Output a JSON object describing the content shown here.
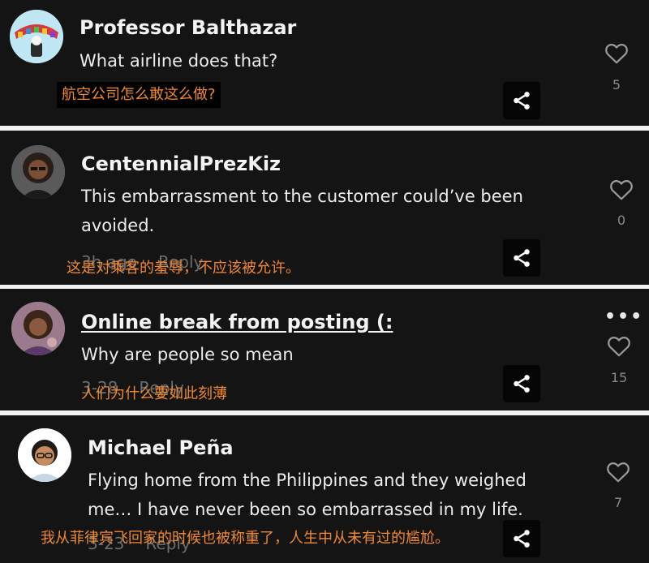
{
  "comments": [
    {
      "username": "Professor Balthazar",
      "text_lines": [
        "What airline does that?"
      ],
      "time": "",
      "reply_label": "",
      "likes": "5",
      "subtitle": "航空公司怎么敢这么做?",
      "avatar_icon": "cartoon-avatar-icon"
    },
    {
      "username": "CentennialPrezKiz",
      "text_lines": [
        "This embarrassment to the customer could’ve been",
        "avoided."
      ],
      "time": "3h ago",
      "reply_label": "Reply",
      "likes": "0",
      "subtitle": "这是对乘客的羞辱，不应该被允许。",
      "avatar_icon": "user-photo-icon"
    },
    {
      "username": "Online break from posting (:",
      "text_lines": [
        "Why are people so mean"
      ],
      "time": "3-28",
      "reply_label": "Reply",
      "likes": "15",
      "subtitle": "人们为什么要如此刻薄",
      "avatar_icon": "user-photo-icon",
      "more_label": "•••"
    },
    {
      "username": "Michael Peña",
      "text_lines": [
        "Flying home from the Philippines and they weighed",
        "me… I have never been so embarrassed in my life."
      ],
      "time": "3-23",
      "reply_label": "Reply",
      "likes": "7",
      "subtitle": "我从菲律宾飞回家的时候也被称重了，人生中从未有过的尴尬。",
      "avatar_icon": "user-photo-icon"
    }
  ],
  "colors": {
    "card_bg": "#141414",
    "separator": "#f2f2f2",
    "subtitle": "#f0882f",
    "username": "#f3f3f3",
    "meta": "#6d6d6d"
  },
  "icons": {
    "share": "share-icon",
    "like": "heart-icon",
    "more": "more-options-icon"
  }
}
